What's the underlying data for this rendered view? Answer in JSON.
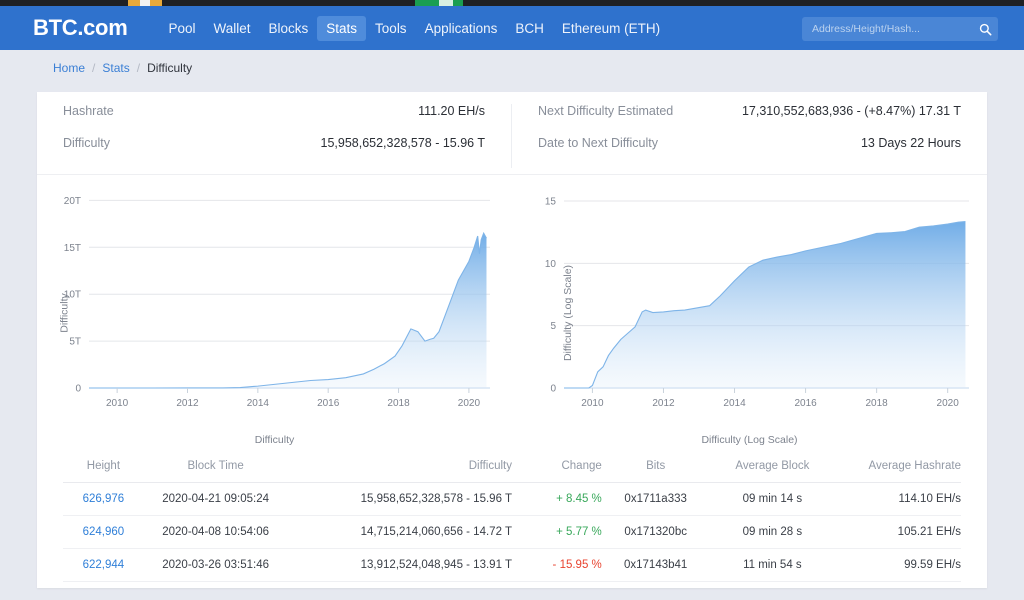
{
  "header": {
    "logo": "BTC.com",
    "nav": [
      {
        "label": "Pool",
        "active": false
      },
      {
        "label": "Wallet",
        "active": false
      },
      {
        "label": "Blocks",
        "active": false
      },
      {
        "label": "Stats",
        "active": true
      },
      {
        "label": "Tools",
        "active": false
      },
      {
        "label": "Applications",
        "active": false
      },
      {
        "label": "BCH",
        "active": false
      },
      {
        "label": "Ethereum (ETH)",
        "active": false
      }
    ],
    "search": {
      "placeholder": "Address/Height/Hash...",
      "value": "",
      "icon": "search-icon"
    },
    "colors": {
      "header_blue": "#2f72cd",
      "active_nav_blue": "#4f8cdb",
      "page_background": "#e6e9f0"
    }
  },
  "breadcrumb": {
    "home": "Home",
    "sep1": "/",
    "stats": "Stats",
    "sep2": "/",
    "current": "Difficulty"
  },
  "summary": {
    "hashrate_label": "Hashrate",
    "hashrate_value": "111.20 EH/s",
    "difficulty_label": "Difficulty",
    "difficulty_value": "15,958,652,328,578 - 15.96 T",
    "next_difficulty_label": "Next Difficulty Estimated",
    "next_difficulty_value": "17,310,552,683,936 - (+8.47%) 17.31 T",
    "date_next_label": "Date to Next Difficulty",
    "date_next_value": "13 Days 22 Hours"
  },
  "chart_data": [
    {
      "type": "area",
      "id": "difficulty-linear",
      "title": "",
      "xlabel": "Difficulty",
      "ylabel": "Difficulty",
      "yticks": [
        "0",
        "5T",
        "10T",
        "15T",
        "20T"
      ],
      "ytick_values": [
        0,
        5,
        10,
        15,
        20
      ],
      "xticks": [
        "2010",
        "2012",
        "2014",
        "2016",
        "2018",
        "2020"
      ],
      "xtick_values": [
        2010,
        2012,
        2014,
        2016,
        2018,
        2020
      ],
      "xlim": [
        2009.2,
        2020.6
      ],
      "ylim": [
        0,
        21
      ],
      "grid": true,
      "legend": "none",
      "x": [
        2009.2,
        2010,
        2011,
        2012,
        2013,
        2013.5,
        2014,
        2014.5,
        2015,
        2015.5,
        2016,
        2016.5,
        2017,
        2017.3,
        2017.6,
        2017.9,
        2018.1,
        2018.35,
        2018.55,
        2018.75,
        2018.9,
        2019.0,
        2019.15,
        2019.3,
        2019.5,
        2019.7,
        2019.85,
        2020.0,
        2020.15,
        2020.25,
        2020.3,
        2020.35,
        2020.42,
        2020.5
      ],
      "y": [
        0,
        0,
        0.0008,
        0.003,
        0.01,
        0.05,
        0.2,
        0.4,
        0.6,
        0.8,
        0.9,
        1.1,
        1.5,
        2.0,
        2.6,
        3.4,
        4.5,
        6.3,
        6.0,
        5.0,
        5.2,
        5.3,
        6.0,
        7.5,
        9.5,
        11.5,
        12.5,
        13.5,
        15.0,
        16.2,
        14.3,
        15.8,
        16.5,
        15.96
      ]
    },
    {
      "type": "area",
      "id": "difficulty-log",
      "title": "",
      "xlabel": "Difficulty (Log Scale)",
      "ylabel": "Difficulty (Log Scale)",
      "yticks": [
        "0",
        "5",
        "10",
        "15"
      ],
      "ytick_values": [
        0,
        5,
        10,
        15
      ],
      "xticks": [
        "2010",
        "2012",
        "2014",
        "2016",
        "2018",
        "2020"
      ],
      "xtick_values": [
        2010,
        2012,
        2014,
        2016,
        2018,
        2020
      ],
      "xlim": [
        2009.2,
        2020.6
      ],
      "ylim": [
        0,
        15.8
      ],
      "grid": true,
      "legend": "none",
      "x": [
        2009.2,
        2009.9,
        2010.0,
        2010.15,
        2010.3,
        2010.45,
        2010.6,
        2010.8,
        2011.0,
        2011.2,
        2011.4,
        2011.5,
        2011.7,
        2012.0,
        2012.3,
        2012.6,
        2013.0,
        2013.3,
        2013.6,
        2014.0,
        2014.4,
        2014.8,
        2015.2,
        2015.6,
        2016.0,
        2016.5,
        2017.0,
        2017.5,
        2018.0,
        2018.4,
        2018.8,
        2019.2,
        2019.6,
        2020.0,
        2020.3,
        2020.5
      ],
      "y": [
        0,
        0,
        0.2,
        1.3,
        1.7,
        2.6,
        3.2,
        3.9,
        4.4,
        4.9,
        6.1,
        6.25,
        6.05,
        6.1,
        6.2,
        6.25,
        6.45,
        6.6,
        7.4,
        8.6,
        9.7,
        10.25,
        10.5,
        10.7,
        11.0,
        11.3,
        11.6,
        12.0,
        12.4,
        12.45,
        12.55,
        12.9,
        13.0,
        13.15,
        13.3,
        13.35
      ]
    }
  ],
  "table": {
    "columns": [
      "Height",
      "Block Time",
      "Difficulty",
      "Change",
      "Bits",
      "Average Block",
      "Average Hashrate"
    ],
    "rows": [
      {
        "height": "626,976",
        "block_time": "2020-04-21 09:05:24",
        "difficulty": "15,958,652,328,578 - 15.96 T",
        "change": "+ 8.45 %",
        "change_sign": "positive",
        "bits": "0x1711a333",
        "average_block": "09 min 14 s",
        "average_hashrate": "114.10 EH/s"
      },
      {
        "height": "624,960",
        "block_time": "2020-04-08 10:54:06",
        "difficulty": "14,715,214,060,656 - 14.72 T",
        "change": "+ 5.77 %",
        "change_sign": "positive",
        "bits": "0x171320bc",
        "average_block": "09 min 28 s",
        "average_hashrate": "105.21 EH/s"
      },
      {
        "height": "622,944",
        "block_time": "2020-03-26 03:51:46",
        "difficulty": "13,912,524,048,945 - 13.91 T",
        "change": "- 15.95 %",
        "change_sign": "negative",
        "bits": "0x17143b41",
        "average_block": "11 min 54 s",
        "average_hashrate": "99.59 EH/s"
      }
    ]
  }
}
